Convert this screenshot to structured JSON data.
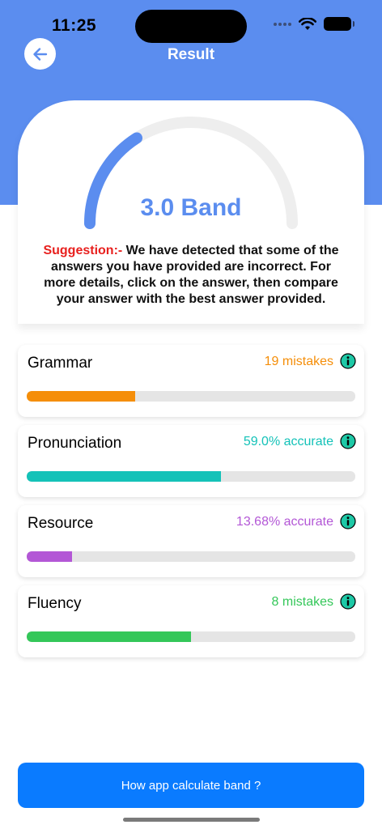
{
  "status_bar": {
    "time": "11:25"
  },
  "header": {
    "title": "Result",
    "back_icon": "arrow-left-icon"
  },
  "score": {
    "band_label": "3.0 Band",
    "gauge_fraction": 0.32,
    "suggestion_label": "Suggestion:-",
    "suggestion_text": " We have detected that some of the answers you have provided are incorrect. For more details, click on the answer, then compare your answer with the best answer provided."
  },
  "metrics": [
    {
      "name": "Grammar",
      "value": "19 mistakes",
      "color": "#f58e09",
      "fill": 0.33
    },
    {
      "name": "Pronunciation",
      "value": "59.0% accurate",
      "color": "#14c2b8",
      "fill": 0.59
    },
    {
      "name": "Resource",
      "value": "13.68% accurate",
      "color": "#b357d6",
      "fill": 0.1368
    },
    {
      "name": "Fluency",
      "value": "8 mistakes",
      "color": "#34c759",
      "fill": 0.5
    }
  ],
  "colors": {
    "accent": "#5b8def",
    "button": "#0a7bff",
    "info_icon": "#1ec8a6"
  },
  "footer": {
    "calc_button_label": "How app calculate band ?"
  }
}
